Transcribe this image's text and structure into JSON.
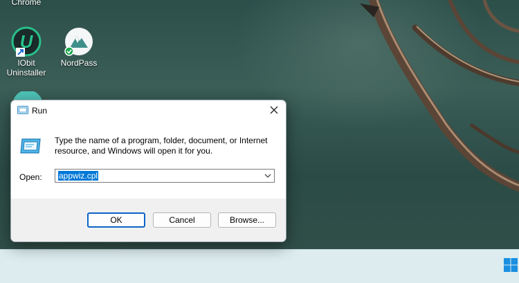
{
  "desktop": {
    "icons": [
      {
        "label": "Chrome"
      },
      {
        "label": "IObit Uninstaller"
      },
      {
        "label": "NordPass"
      }
    ]
  },
  "run_dialog": {
    "title": "Run",
    "description": "Type the name of a program, folder, document, or Internet resource, and Windows will open it for you.",
    "open_label": "Open:",
    "open_value": "appwiz.cpl",
    "buttons": {
      "ok": "OK",
      "cancel": "Cancel",
      "browse": "Browse..."
    }
  },
  "colors": {
    "accent": "#0078d7",
    "taskbar": "#dcecef"
  }
}
